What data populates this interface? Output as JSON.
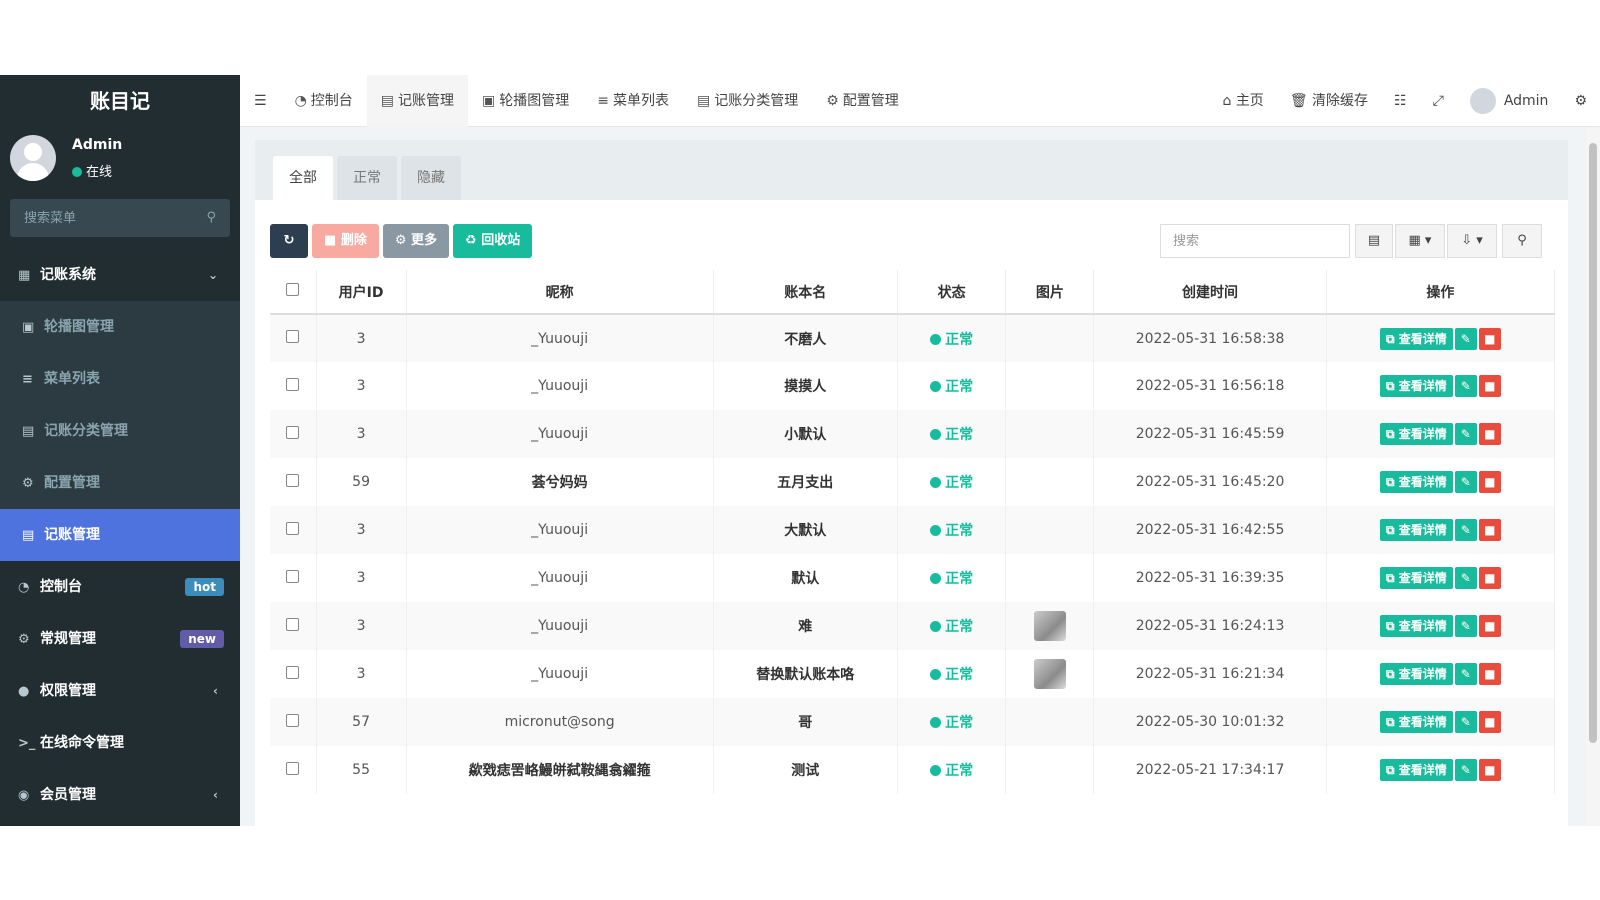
{
  "sidebar": {
    "brand": "账目记",
    "user_name": "Admin",
    "user_status": "在线",
    "search_placeholder": "搜索菜单",
    "items": [
      {
        "label": "记账系统",
        "icon": "book-icon",
        "arrow": "⌄"
      },
      {
        "label": "轮播图管理",
        "icon": "image-icon"
      },
      {
        "label": "菜单列表",
        "icon": "list-icon"
      },
      {
        "label": "记账分类管理",
        "icon": "file-icon"
      },
      {
        "label": "配置管理",
        "icon": "gear-icon"
      },
      {
        "label": "记账管理",
        "icon": "file-icon"
      },
      {
        "label": "控制台",
        "icon": "dashboard-icon",
        "badge": "hot"
      },
      {
        "label": "常规管理",
        "icon": "cogs-icon",
        "badge": "new"
      },
      {
        "label": "权限管理",
        "icon": "users-icon",
        "arrow": "‹"
      },
      {
        "label": "在线命令管理",
        "icon": "terminal-icon"
      },
      {
        "label": "会员管理",
        "icon": "user-circle-icon",
        "arrow": "‹"
      }
    ]
  },
  "topbar": {
    "nav": [
      "控制台",
      "记账管理",
      "轮播图管理",
      "菜单列表",
      "记账分类管理",
      "配置管理"
    ],
    "home": "主页",
    "clear_cache": "清除缓存",
    "admin": "Admin"
  },
  "tabs": [
    "全部",
    "正常",
    "隐藏"
  ],
  "toolbar": {
    "delete": "删除",
    "more": "更多",
    "recycle": "回收站",
    "search_placeholder": "搜索"
  },
  "table": {
    "headers": [
      "用户ID",
      "昵称",
      "账本名",
      "状态",
      "图片",
      "创建时间",
      "操作"
    ],
    "view_label": "查看详情",
    "rows": [
      {
        "user_id": "3",
        "nickname": "_Yuuouji",
        "book": "不磨人",
        "status": "正常",
        "has_image": false,
        "created": "2022-05-31 16:58:38"
      },
      {
        "user_id": "3",
        "nickname": "_Yuuouji",
        "book": "摸摸人",
        "status": "正常",
        "has_image": false,
        "created": "2022-05-31 16:56:18"
      },
      {
        "user_id": "3",
        "nickname": "_Yuuouji",
        "book": "小默认",
        "status": "正常",
        "has_image": false,
        "created": "2022-05-31 16:45:59"
      },
      {
        "user_id": "59",
        "nickname": "荟兮妈妈",
        "book": "五月支出",
        "status": "正常",
        "has_image": false,
        "created": "2022-05-31 16:45:20"
      },
      {
        "user_id": "3",
        "nickname": "_Yuuouji",
        "book": "大默认",
        "status": "正常",
        "has_image": false,
        "created": "2022-05-31 16:42:55"
      },
      {
        "user_id": "3",
        "nickname": "_Yuuouji",
        "book": "默认",
        "status": "正常",
        "has_image": false,
        "created": "2022-05-31 16:39:35"
      },
      {
        "user_id": "3",
        "nickname": "_Yuuouji",
        "book": "难",
        "status": "正常",
        "has_image": true,
        "created": "2022-05-31 16:24:13"
      },
      {
        "user_id": "3",
        "nickname": "_Yuuouji",
        "book": "替换默认账本咯",
        "status": "正常",
        "has_image": true,
        "created": "2022-05-31 16:21:34"
      },
      {
        "user_id": "57",
        "nickname": "micronut@song",
        "book": "哥",
        "status": "正常",
        "has_image": false,
        "created": "2022-05-30 10:01:32"
      },
      {
        "user_id": "55",
        "nickname": "歘戣痣罟峈鰻皏弑鞍縄翕糴箍",
        "book": "测试",
        "status": "正常",
        "has_image": false,
        "created": "2022-05-21 17:34:17"
      }
    ]
  },
  "colors": {
    "sidebar": "#222d32",
    "active": "#4e73df",
    "success": "#18bc9c",
    "danger": "#e74c3c"
  }
}
